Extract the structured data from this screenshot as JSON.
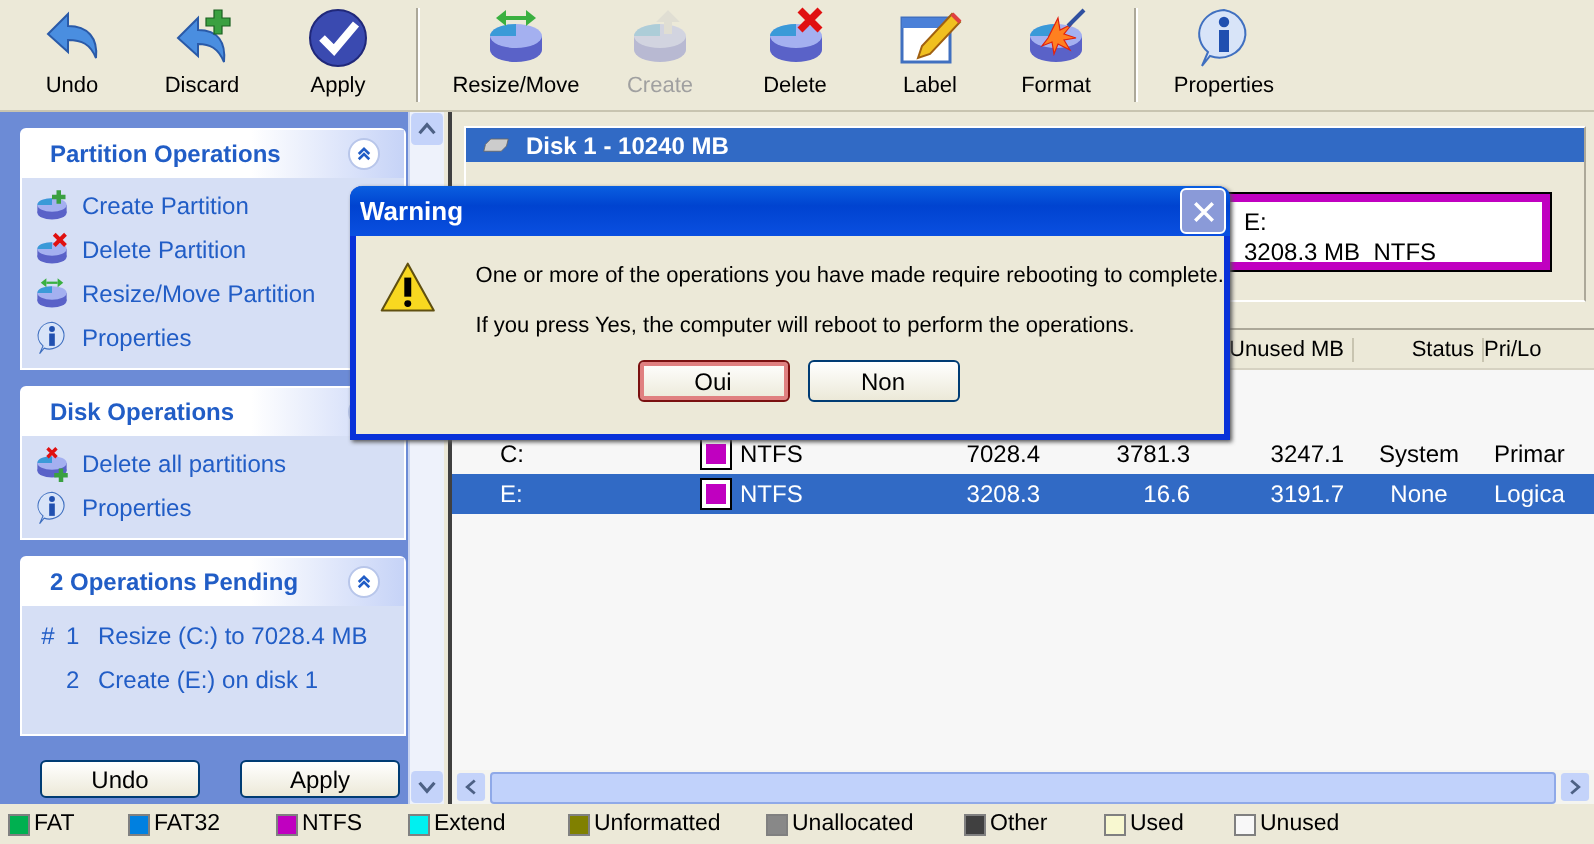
{
  "toolbar": {
    "groups": [
      [
        {
          "kind": "undo",
          "label": "Undo",
          "disabled": false
        },
        {
          "kind": "discard",
          "label": "Discard",
          "disabled": false
        },
        {
          "kind": "apply",
          "label": "Apply",
          "disabled": false
        }
      ],
      [
        {
          "kind": "resize",
          "label": "Resize/Move",
          "disabled": false
        },
        {
          "kind": "create",
          "label": "Create",
          "disabled": true
        },
        {
          "kind": "delete",
          "label": "Delete",
          "disabled": false
        },
        {
          "kind": "label",
          "label": "Label",
          "disabled": false
        },
        {
          "kind": "format",
          "label": "Format",
          "disabled": false
        }
      ],
      [
        {
          "kind": "properties",
          "label": "Properties",
          "disabled": false
        }
      ]
    ]
  },
  "sidebar": {
    "panels": [
      {
        "title": "Partition Operations",
        "items": [
          {
            "kind": "create",
            "label": "Create Partition"
          },
          {
            "kind": "delete",
            "label": "Delete Partition"
          },
          {
            "kind": "resize",
            "label": "Resize/Move Partition"
          },
          {
            "kind": "properties",
            "label": "Properties"
          }
        ]
      },
      {
        "title": "Disk Operations",
        "items": [
          {
            "kind": "delete-all",
            "label": "Delete all partitions"
          },
          {
            "kind": "properties",
            "label": "Properties"
          }
        ]
      },
      {
        "title": "2 Operations Pending",
        "pending": [
          {
            "mark": "#",
            "number": "1",
            "text": "Resize (C:) to 7028.4 MB"
          },
          {
            "number": "2",
            "text": "Create (E:) on disk 1"
          }
        ]
      }
    ],
    "buttons": [
      "Undo",
      "Apply"
    ]
  },
  "disk": {
    "title": "Disk 1 - 10240 MB",
    "partitions": [
      {
        "name": "E:",
        "info": "3208.3 MB  NTFS",
        "color": "#c000c0"
      }
    ]
  },
  "table": {
    "headers": {
      "unused": "Unused MB",
      "status": "Status",
      "pri_log": "Pri/Lo"
    },
    "rows": [
      {
        "partition": "C:",
        "color": "#c000c0",
        "type": "NTFS",
        "size": "7028.4",
        "used": "3781.3",
        "unused": "3247.1",
        "status": "System",
        "pri_log": "Primar",
        "selected": false
      },
      {
        "partition": "E:",
        "color": "#c000c0",
        "type": "NTFS",
        "size": "3208.3",
        "used": "16.6",
        "unused": "3191.7",
        "status": "None",
        "pri_log": "Logica",
        "selected": true
      }
    ]
  },
  "legend": [
    {
      "label": "FAT",
      "color": "#00b050"
    },
    {
      "label": "FAT32",
      "color": "#0080e0"
    },
    {
      "label": "NTFS",
      "color": "#c000c0"
    },
    {
      "label": "Extend",
      "color": "#00f0f0"
    },
    {
      "label": "Unformatted",
      "color": "#808000"
    },
    {
      "label": "Unallocated",
      "color": "#888888"
    },
    {
      "label": "Other",
      "color": "#404040"
    },
    {
      "label": "Used",
      "color": "#f8f8d0"
    },
    {
      "label": "Unused",
      "color": "#f8f8f8"
    }
  ],
  "dialog": {
    "title": "Warning",
    "messages": [
      "One or more of the operations you have made require rebooting to complete.",
      "If you press Yes, the computer will reboot to perform the operations."
    ],
    "buttons": [
      {
        "label": "Oui",
        "default": true
      },
      {
        "label": "Non",
        "default": false
      }
    ]
  }
}
